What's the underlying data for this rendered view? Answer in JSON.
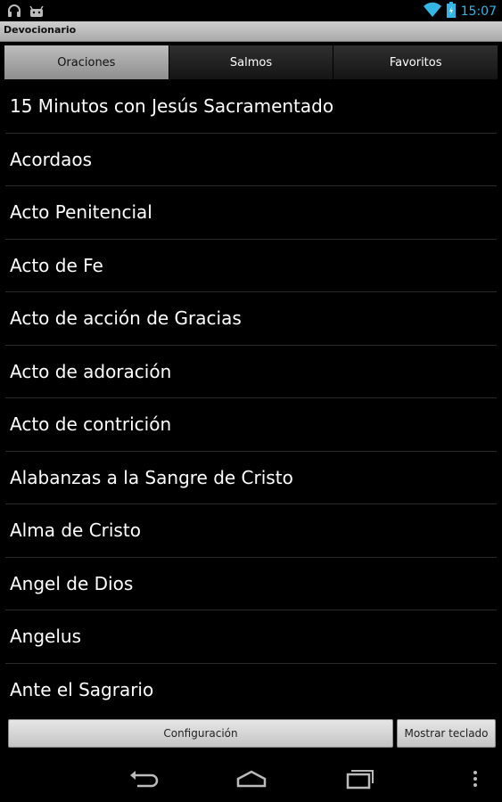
{
  "status_bar": {
    "time": "15:07",
    "icons": [
      "headphones-icon",
      "android-debug-icon",
      "wifi-icon",
      "battery-icon"
    ],
    "accent_color": "#33b5e5"
  },
  "app": {
    "title": "Devocionario"
  },
  "tabs": [
    {
      "label": "Oraciones",
      "active": true
    },
    {
      "label": "Salmos",
      "active": false
    },
    {
      "label": "Favoritos",
      "active": false
    }
  ],
  "prayers": [
    "15 Minutos con Jesús Sacramentado",
    "Acordaos",
    "Acto Penitencial",
    "Acto de Fe",
    "Acto de acción de Gracias",
    "Acto de adoración",
    "Acto de contrición",
    "Alabanzas a la Sangre de Cristo",
    "Alma de Cristo",
    "Angel de Dios",
    "Angelus",
    "Ante el Sagrario"
  ],
  "buttons": {
    "config": "Configuración",
    "keyboard": "Mostrar teclado"
  },
  "nav": [
    "back-icon",
    "home-icon",
    "recent-apps-icon",
    "overflow-menu-icon"
  ]
}
